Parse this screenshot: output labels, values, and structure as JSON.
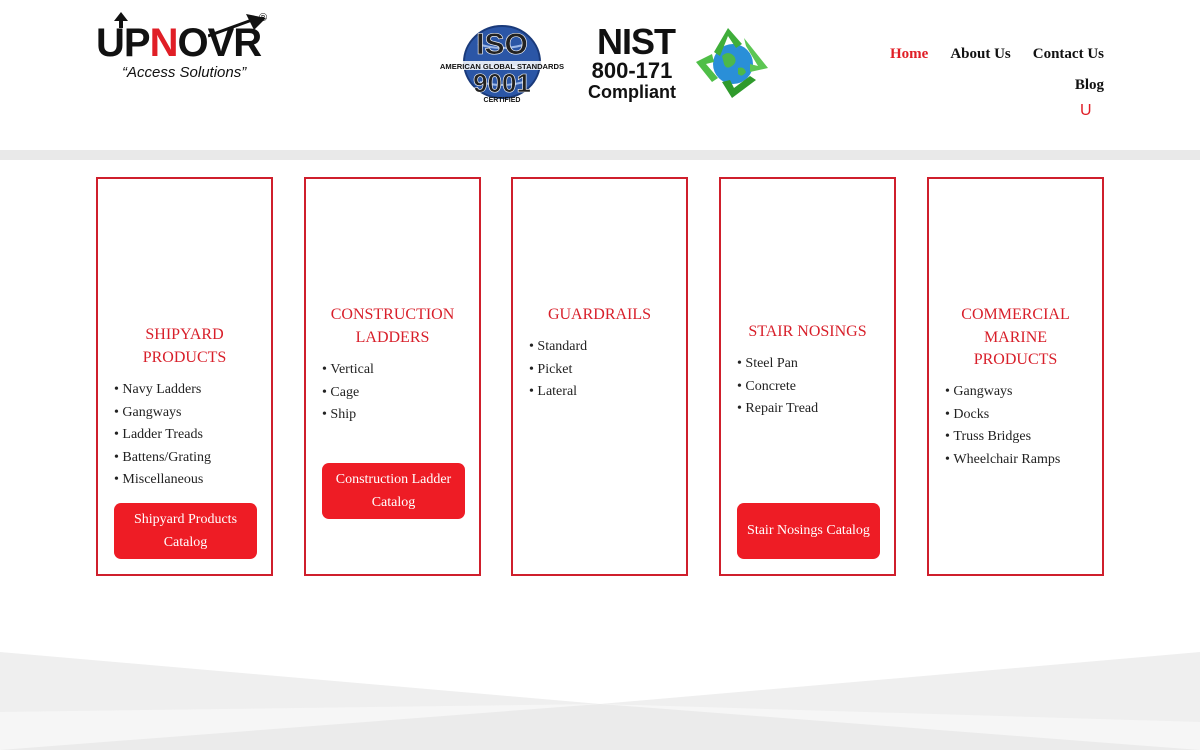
{
  "brand": {
    "logo_text_a": "UP",
    "logo_text_n": "N",
    "logo_text_b": "OVR",
    "registered": "®",
    "tagline": "“Access Solutions”"
  },
  "certifications": {
    "iso_top": "ISO",
    "iso_band": "AMERICAN GLOBAL STANDARDS",
    "iso_num": "9001",
    "iso_certified": "CERTIFIED",
    "nist": "NIST",
    "nist_num": "800-171",
    "nist_compliant": "Compliant",
    "recycle_icon": "recycle-globe-icon"
  },
  "nav": {
    "home": "Home",
    "about": "About Us",
    "contact": "Contact Us",
    "blog": "Blog",
    "toggle": "U"
  },
  "colors": {
    "accent": "#e01e26",
    "button": "#ee1c25",
    "card_border": "#cf1f2c",
    "band": "#e9e9e9"
  },
  "cards": [
    {
      "title_lines": [
        "SHIPYARD",
        "PRODUCTS"
      ],
      "items": [
        "Navy Ladders",
        "Gangways",
        "Ladder Treads",
        "Battens/Grating",
        "Miscellaneous"
      ],
      "button": "Shipyard Products Catalog"
    },
    {
      "title_lines": [
        "CONSTRUCTION",
        "LADDERS"
      ],
      "items": [
        "Vertical",
        "Cage",
        "Ship"
      ],
      "button": "Construction Ladder Catalog"
    },
    {
      "title_lines": [
        "GUARDRAILS"
      ],
      "items": [
        "Standard",
        "Picket",
        "Lateral"
      ]
    },
    {
      "title_lines": [
        "STAIR NOSINGS"
      ],
      "items": [
        "Steel Pan",
        "Concrete",
        "Repair Tread"
      ],
      "button": "Stair Nosings Catalog"
    },
    {
      "title_lines": [
        "COMMERCIAL",
        "MARINE",
        "PRODUCTS"
      ],
      "items": [
        "Gangways",
        "Docks",
        "Truss Bridges",
        "Wheelchair Ramps"
      ]
    }
  ]
}
